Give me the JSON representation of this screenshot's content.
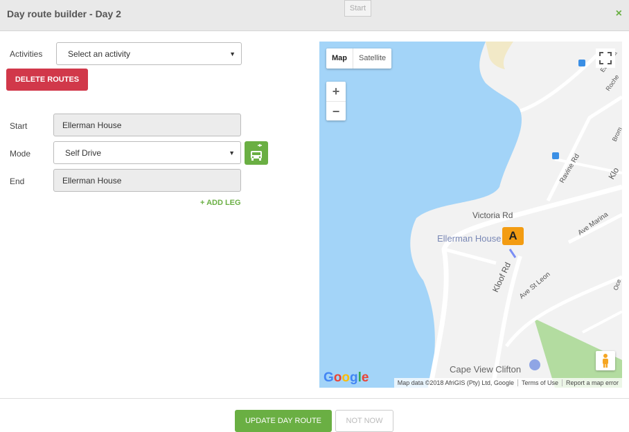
{
  "header": {
    "title": "Day route builder - Day 2",
    "start_ghost": "Start",
    "close_glyph": "×"
  },
  "activities": {
    "label": "Activities",
    "placeholder": "Select an activity"
  },
  "buttons": {
    "delete_routes": "DELETE ROUTES",
    "update_day_route": "UPDATE DAY ROUTE",
    "not_now": "NOT NOW"
  },
  "route": {
    "start_label": "Start",
    "start_value": "Ellerman House",
    "mode_label": "Mode",
    "mode_value": "Self Drive",
    "end_label": "End",
    "end_value": "Ellerman House",
    "add_leg": "+ ADD LEG"
  },
  "map": {
    "type_map": "Map",
    "type_satellite": "Satellite",
    "zoom_in": "+",
    "zoom_out": "−",
    "marker_label": "A",
    "labels": {
      "victoria_rd": "Victoria Rd",
      "ellerman_house": "Ellerman House",
      "kloof_rd": "Kloof Rd",
      "ave_st_leon": "Ave St Leon",
      "ave_marina": "Ave Marina",
      "ravine_rd": "Ravine Rd",
      "cape_view_clifton": "Cape View Clifton",
      "edgewater": "Edgewat",
      "roche": "Roche",
      "brom": "Brom",
      "klo": "Klo",
      "oce": "Oce"
    },
    "attribution": {
      "data": "Map data ©2018 AfriGIS (Pty) Ltd, Google",
      "terms": "Terms of Use",
      "report": "Report a map error"
    },
    "colors": {
      "water": "#a3d4f8",
      "land": "#f2f2f2",
      "park": "#b3dca0",
      "sand": "#f2e9c7",
      "road": "#ffffff"
    }
  },
  "colors": {
    "accent_green": "#6aaf43",
    "danger_red": "#d1384a"
  }
}
